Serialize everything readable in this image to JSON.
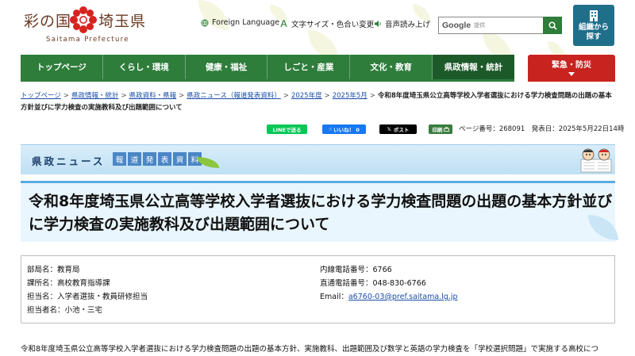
{
  "site": {
    "logo_kanji_a": "彩の国",
    "logo_kanji_b": "埼玉県",
    "logo_en": "Saitama Prefecture",
    "logo_alt": "埼玉県"
  },
  "utility": {
    "foreign_language": "Foreign Language",
    "text_size_color": "文字サイズ・色合い変更",
    "read_aloud": "音声読み上げ"
  },
  "search": {
    "brand": "Google",
    "placeholder": "提供"
  },
  "org_button": {
    "line1": "組織から",
    "line2": "探す"
  },
  "nav": {
    "items": [
      {
        "label": "トップページ"
      },
      {
        "label": "くらし・環境"
      },
      {
        "label": "健康・福祉"
      },
      {
        "label": "しごと・産業"
      },
      {
        "label": "文化・教育"
      },
      {
        "label": "県政情報・統計"
      }
    ]
  },
  "emergency": {
    "label": "緊急・防災"
  },
  "breadcrumb": {
    "links": [
      {
        "label": "トップページ"
      },
      {
        "label": "県政情報・統計"
      },
      {
        "label": "県政資料・県報"
      },
      {
        "label": "県政ニュース（報道発表資料）"
      },
      {
        "label": "2025年度"
      },
      {
        "label": "2025年5月"
      }
    ],
    "separator": ">",
    "current": "令和8年度埼玉県公立高等学校入学者選抜における学力検査問題の出題の基本方針並びに学力検査の実施教科及び出題範囲について"
  },
  "share": {
    "line": "LINEで送る",
    "facebook": "いいね！ 0",
    "x": "ポスト",
    "print": "印刷"
  },
  "page_meta": {
    "text": "ページ番号：268091　発表日：2025年5月22日14時"
  },
  "banner": {
    "title": "県政ニュース",
    "tag_chars": [
      "報",
      "道",
      "発",
      "表",
      "資",
      "料"
    ]
  },
  "article": {
    "title": "令和8年度埼玉県公立高等学校入学者選抜における学力検査問題の出題の基本方針並びに学力検査の実施教科及び出題範囲について",
    "body_start": "令和8年度埼玉県公立高等学校入学者選抜における学力検査問題の出題の基本方針、実施教科、出題範囲及び数学と英語の学力検査を「学校選択問題」で実施する高校につ"
  },
  "contact": {
    "department": "部局名：教育局",
    "section": "課所名：高校教育指導課",
    "staff_unit": "担当名：入学者選抜・教員研修担当",
    "staff_name": "担当者名：小池・三宅",
    "ext_phone": "内線電話番号：6766",
    "direct_phone": "直通電話番号：048-830-6766",
    "email_label": "Email：",
    "email": "a6760-03@pref.saitama.lg.jp"
  },
  "colors": {
    "nav_green": "#2e7d3b",
    "emergency_red": "#c8231f",
    "org_blue": "#1f6f8b",
    "banner_blue": "#4b86c6",
    "link_blue": "#1a4ea8"
  }
}
